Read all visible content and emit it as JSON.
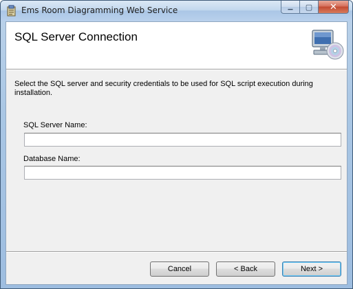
{
  "window": {
    "title": "Ems Room Diagramming Web Service"
  },
  "caption_buttons": {
    "minimize_glyph": "▁",
    "maximize_glyph": "▢",
    "close_glyph": "✕"
  },
  "banner": {
    "title": "SQL Server Connection",
    "icon": "computer-with-disc-icon"
  },
  "description": "Select the SQL server and security credentials to be used for SQL script execution during installation.",
  "fields": {
    "server_label": "SQL Server Name:",
    "server_value": "",
    "database_label": "Database Name:",
    "database_value": ""
  },
  "buttons": {
    "cancel": "Cancel",
    "back": "< Back",
    "next": "Next >"
  }
}
